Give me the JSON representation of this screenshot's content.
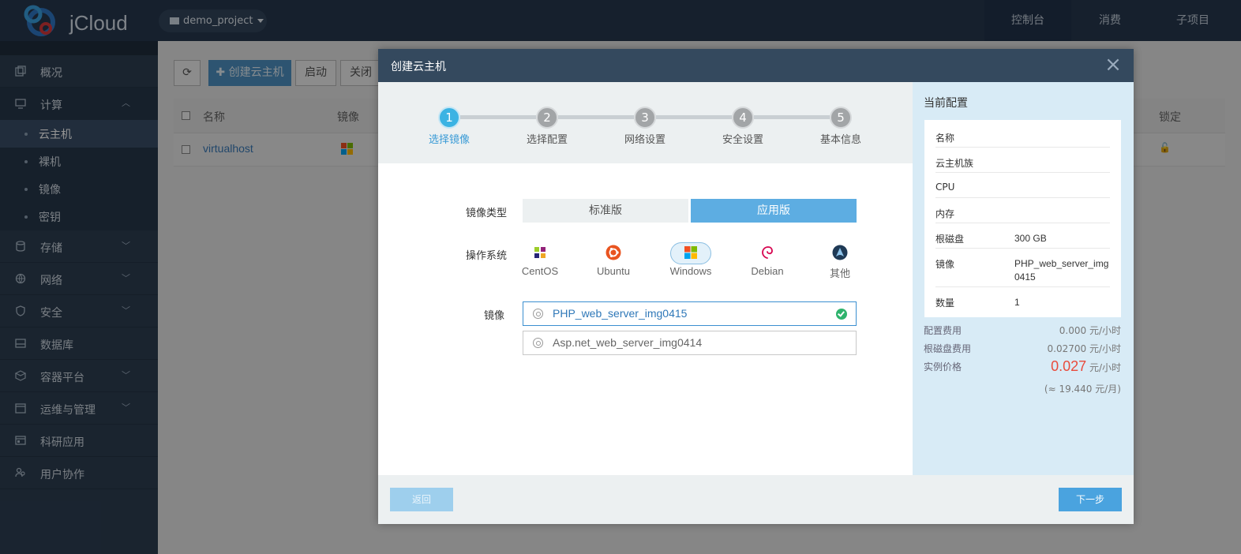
{
  "app": {
    "logo_text": "jCloud",
    "project": "demo_project"
  },
  "topnav": [
    "控制台",
    "消费",
    "子项目"
  ],
  "sidebar": {
    "overview": "概况",
    "compute": "计算",
    "compute_items": [
      "云主机",
      "裸机",
      "镜像",
      "密钥"
    ],
    "storage": "存储",
    "network": "网络",
    "security": "安全",
    "database": "数据库",
    "container": "容器平台",
    "ops": "运维与管理",
    "research": "科研应用",
    "collab": "用户协作"
  },
  "background": {
    "create_button": "✚ 创建云主机",
    "start_button": "启动",
    "close_button": "关闭",
    "columns": {
      "name": "名称",
      "image": "镜像",
      "lock": "锁定"
    },
    "row_name": "virtualhost"
  },
  "modal": {
    "title": "创建云主机",
    "close_glyph": "×",
    "steps": [
      {
        "num": "1",
        "label": "选择镜像"
      },
      {
        "num": "2",
        "label": "选择配置"
      },
      {
        "num": "3",
        "label": "网络设置"
      },
      {
        "num": "4",
        "label": "安全设置"
      },
      {
        "num": "5",
        "label": "基本信息"
      }
    ],
    "active_step": 1,
    "form": {
      "image_type_label": "镜像类型",
      "image_type_options": [
        "标准版",
        "应用版"
      ],
      "image_type_selected": "应用版",
      "os_label": "操作系统",
      "os_options": [
        "CentOS",
        "Ubuntu",
        "Windows",
        "Debian",
        "其他"
      ],
      "os_selected": "Windows",
      "image_label": "镜像",
      "images": [
        "PHP_web_server_img0415",
        "Asp.net_web_server_img0414"
      ],
      "image_selected": "PHP_web_server_img0415"
    },
    "config": {
      "title": "当前配置",
      "rows": [
        {
          "key": "名称",
          "value": ""
        },
        {
          "key": "云主机族",
          "value": ""
        },
        {
          "key": "CPU",
          "value": ""
        },
        {
          "key": "内存",
          "value": ""
        },
        {
          "key": "根磁盘",
          "value": "300 GB"
        },
        {
          "key": "镜像",
          "value": "PHP_web_server_img0415"
        },
        {
          "key": "数量",
          "value": "1"
        }
      ],
      "fees": {
        "config_fee_label": "配置费用",
        "config_fee": "0.000 元/小时",
        "disk_fee_label": "根磁盘费用",
        "disk_fee": "0.02700 元/小时",
        "instance_price_label": "实例价格",
        "instance_price": "0.027",
        "instance_price_unit": "元/小时",
        "monthly": "(≈ 19.440 元/月)"
      }
    },
    "footer": {
      "back": "返回",
      "next": "下一步"
    }
  },
  "colors": {
    "accent": "#5dade2",
    "header": "#34495e",
    "price": "#e94b3c",
    "topbar": "#26384f"
  }
}
